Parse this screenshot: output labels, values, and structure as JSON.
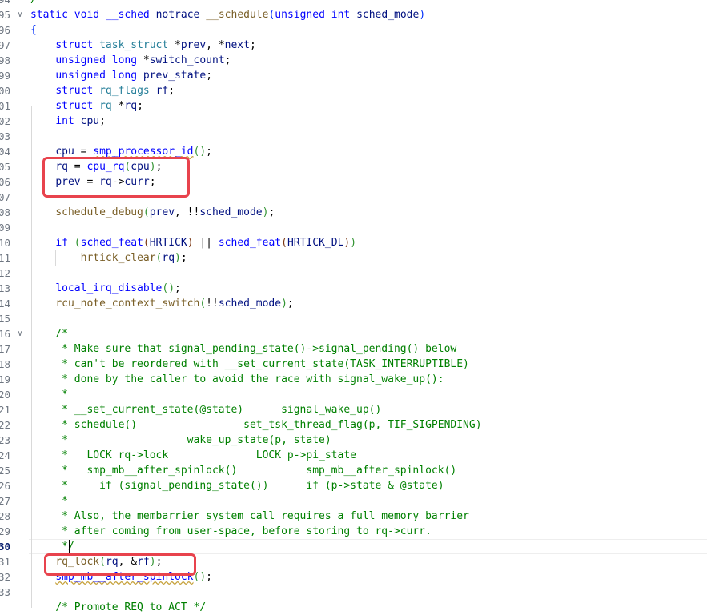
{
  "editor": {
    "line_numbers": [
      "94",
      "95",
      "96",
      "97",
      "98",
      "99",
      "00",
      "01",
      "02",
      "03",
      "04",
      "05",
      "06",
      "07",
      "08",
      "09",
      "10",
      "11",
      "12",
      "13",
      "14",
      "15",
      "16",
      "17",
      "18",
      "19",
      "20",
      "21",
      "22",
      "23",
      "24",
      "25",
      "26",
      "27",
      "28",
      "29",
      "30",
      "31",
      "32",
      "33"
    ],
    "active_line": "30",
    "lines": [
      [
        [
          "cm",
          "/"
        ]
      ],
      [
        [
          "kw",
          "static"
        ],
        [
          "pl",
          " "
        ],
        [
          "kw",
          "void"
        ],
        [
          "pl",
          " "
        ],
        [
          "mac",
          "__sched"
        ],
        [
          "pl",
          " "
        ],
        [
          "va",
          "notrace"
        ],
        [
          "pl",
          " "
        ],
        [
          "fn",
          "__schedule"
        ],
        [
          "br1",
          "("
        ],
        [
          "kw",
          "unsigned"
        ],
        [
          "pl",
          " "
        ],
        [
          "kw",
          "int"
        ],
        [
          "pl",
          " "
        ],
        [
          "va",
          "sched_mode"
        ],
        [
          "br1",
          ")"
        ]
      ],
      [
        [
          "br1",
          "{"
        ]
      ],
      [
        [
          "pl",
          "    "
        ],
        [
          "kw",
          "struct"
        ],
        [
          "pl",
          " "
        ],
        [
          "ty",
          "task_struct"
        ],
        [
          "pl",
          " *"
        ],
        [
          "va",
          "prev"
        ],
        [
          "pl",
          ", *"
        ],
        [
          "va",
          "next"
        ],
        [
          "pl",
          ";"
        ]
      ],
      [
        [
          "pl",
          "    "
        ],
        [
          "kw",
          "unsigned"
        ],
        [
          "pl",
          " "
        ],
        [
          "kw",
          "long"
        ],
        [
          "pl",
          " *"
        ],
        [
          "va",
          "switch_count"
        ],
        [
          "pl",
          ";"
        ]
      ],
      [
        [
          "pl",
          "    "
        ],
        [
          "kw",
          "unsigned"
        ],
        [
          "pl",
          " "
        ],
        [
          "kw",
          "long"
        ],
        [
          "pl",
          " "
        ],
        [
          "va",
          "prev_state"
        ],
        [
          "pl",
          ";"
        ]
      ],
      [
        [
          "pl",
          "    "
        ],
        [
          "kw",
          "struct"
        ],
        [
          "pl",
          " "
        ],
        [
          "ty",
          "rq_flags"
        ],
        [
          "pl",
          " "
        ],
        [
          "va",
          "rf"
        ],
        [
          "pl",
          ";"
        ]
      ],
      [
        [
          "pl",
          "    "
        ],
        [
          "kw",
          "struct"
        ],
        [
          "pl",
          " "
        ],
        [
          "ty",
          "rq"
        ],
        [
          "pl",
          " *"
        ],
        [
          "va",
          "rq"
        ],
        [
          "pl",
          ";"
        ]
      ],
      [
        [
          "pl",
          "    "
        ],
        [
          "kw",
          "int"
        ],
        [
          "pl",
          " "
        ],
        [
          "va",
          "cpu"
        ],
        [
          "pl",
          ";"
        ]
      ],
      [],
      [
        [
          "pl",
          "    "
        ],
        [
          "va",
          "cpu"
        ],
        [
          "pl",
          " = "
        ],
        [
          "macu",
          "smp_processor_id"
        ],
        [
          "br2",
          "()"
        ],
        [
          "pl",
          ";"
        ]
      ],
      [
        [
          "pl",
          "    "
        ],
        [
          "va",
          "rq"
        ],
        [
          "pl",
          " = "
        ],
        [
          "mac",
          "cpu_rq"
        ],
        [
          "br2",
          "("
        ],
        [
          "va",
          "cpu"
        ],
        [
          "br2",
          ")"
        ],
        [
          "pl",
          ";"
        ]
      ],
      [
        [
          "pl",
          "    "
        ],
        [
          "va",
          "prev"
        ],
        [
          "pl",
          " = "
        ],
        [
          "va",
          "rq"
        ],
        [
          "pl",
          "->"
        ],
        [
          "va",
          "curr"
        ],
        [
          "pl",
          ";"
        ]
      ],
      [],
      [
        [
          "pl",
          "    "
        ],
        [
          "fn",
          "schedule_debug"
        ],
        [
          "br2",
          "("
        ],
        [
          "va",
          "prev"
        ],
        [
          "pl",
          ", !!"
        ],
        [
          "va",
          "sched_mode"
        ],
        [
          "br2",
          ")"
        ],
        [
          "pl",
          ";"
        ]
      ],
      [],
      [
        [
          "pl",
          "    "
        ],
        [
          "kw",
          "if"
        ],
        [
          "pl",
          " "
        ],
        [
          "br2",
          "("
        ],
        [
          "mac",
          "sched_feat"
        ],
        [
          "br3",
          "("
        ],
        [
          "va",
          "HRTICK"
        ],
        [
          "br3",
          ")"
        ],
        [
          "pl",
          " || "
        ],
        [
          "mac",
          "sched_feat"
        ],
        [
          "br3",
          "("
        ],
        [
          "va",
          "HRTICK_DL"
        ],
        [
          "br3",
          ")"
        ],
        [
          "br2",
          ")"
        ]
      ],
      [
        [
          "pl",
          "        "
        ],
        [
          "fn",
          "hrtick_clear"
        ],
        [
          "br2",
          "("
        ],
        [
          "va",
          "rq"
        ],
        [
          "br2",
          ")"
        ],
        [
          "pl",
          ";"
        ]
      ],
      [],
      [
        [
          "pl",
          "    "
        ],
        [
          "mac",
          "local_irq_disable"
        ],
        [
          "br2",
          "()"
        ],
        [
          "pl",
          ";"
        ]
      ],
      [
        [
          "pl",
          "    "
        ],
        [
          "fn",
          "rcu_note_context_switch"
        ],
        [
          "br2",
          "("
        ],
        [
          "pl",
          "!!"
        ],
        [
          "va",
          "sched_mode"
        ],
        [
          "br2",
          ")"
        ],
        [
          "pl",
          ";"
        ]
      ],
      [],
      [
        [
          "pl",
          "    "
        ],
        [
          "cm",
          "/*"
        ]
      ],
      [
        [
          "pl",
          "    "
        ],
        [
          "cm",
          " * Make sure that signal_pending_state()->signal_pending() below"
        ]
      ],
      [
        [
          "pl",
          "    "
        ],
        [
          "cm",
          " * can't be reordered with __set_current_state(TASK_INTERRUPTIBLE)"
        ]
      ],
      [
        [
          "pl",
          "    "
        ],
        [
          "cm",
          " * done by the caller to avoid the race with signal_wake_up():"
        ]
      ],
      [
        [
          "pl",
          "    "
        ],
        [
          "cm",
          " *"
        ]
      ],
      [
        [
          "pl",
          "    "
        ],
        [
          "cm",
          " * __set_current_state(@state)      signal_wake_up()"
        ]
      ],
      [
        [
          "pl",
          "    "
        ],
        [
          "cm",
          " * schedule()                 set_tsk_thread_flag(p, TIF_SIGPENDING)"
        ]
      ],
      [
        [
          "pl",
          "    "
        ],
        [
          "cm",
          " *                   wake_up_state(p, state)"
        ]
      ],
      [
        [
          "pl",
          "    "
        ],
        [
          "cm",
          " *   LOCK rq->lock              LOCK p->pi_state"
        ]
      ],
      [
        [
          "pl",
          "    "
        ],
        [
          "cm",
          " *   smp_mb__after_spinlock()           smp_mb__after_spinlock()"
        ]
      ],
      [
        [
          "pl",
          "    "
        ],
        [
          "cm",
          " *     if (signal_pending_state())      if (p->state & @state)"
        ]
      ],
      [
        [
          "pl",
          "    "
        ],
        [
          "cm",
          " *"
        ]
      ],
      [
        [
          "pl",
          "    "
        ],
        [
          "cm",
          " * Also, the membarrier system call requires a full memory barrier"
        ]
      ],
      [
        [
          "pl",
          "    "
        ],
        [
          "cm",
          " * after coming from user-space, before storing to rq->curr."
        ]
      ],
      [
        [
          "pl",
          "    "
        ],
        [
          "cm",
          " */"
        ]
      ],
      [
        [
          "pl",
          "    "
        ],
        [
          "fn",
          "rq_lock"
        ],
        [
          "br2",
          "("
        ],
        [
          "va",
          "rq"
        ],
        [
          "pl",
          ", &"
        ],
        [
          "va",
          "rf"
        ],
        [
          "br2",
          ")"
        ],
        [
          "pl",
          ";"
        ]
      ],
      [
        [
          "pl",
          "    "
        ],
        [
          "macu",
          "smp_mb__after_spinlock"
        ],
        [
          "br2",
          "()"
        ],
        [
          "pl",
          ";"
        ]
      ],
      [],
      [
        [
          "pl",
          "    "
        ],
        [
          "cm",
          "/* Promote REQ to ACT */"
        ]
      ]
    ]
  }
}
